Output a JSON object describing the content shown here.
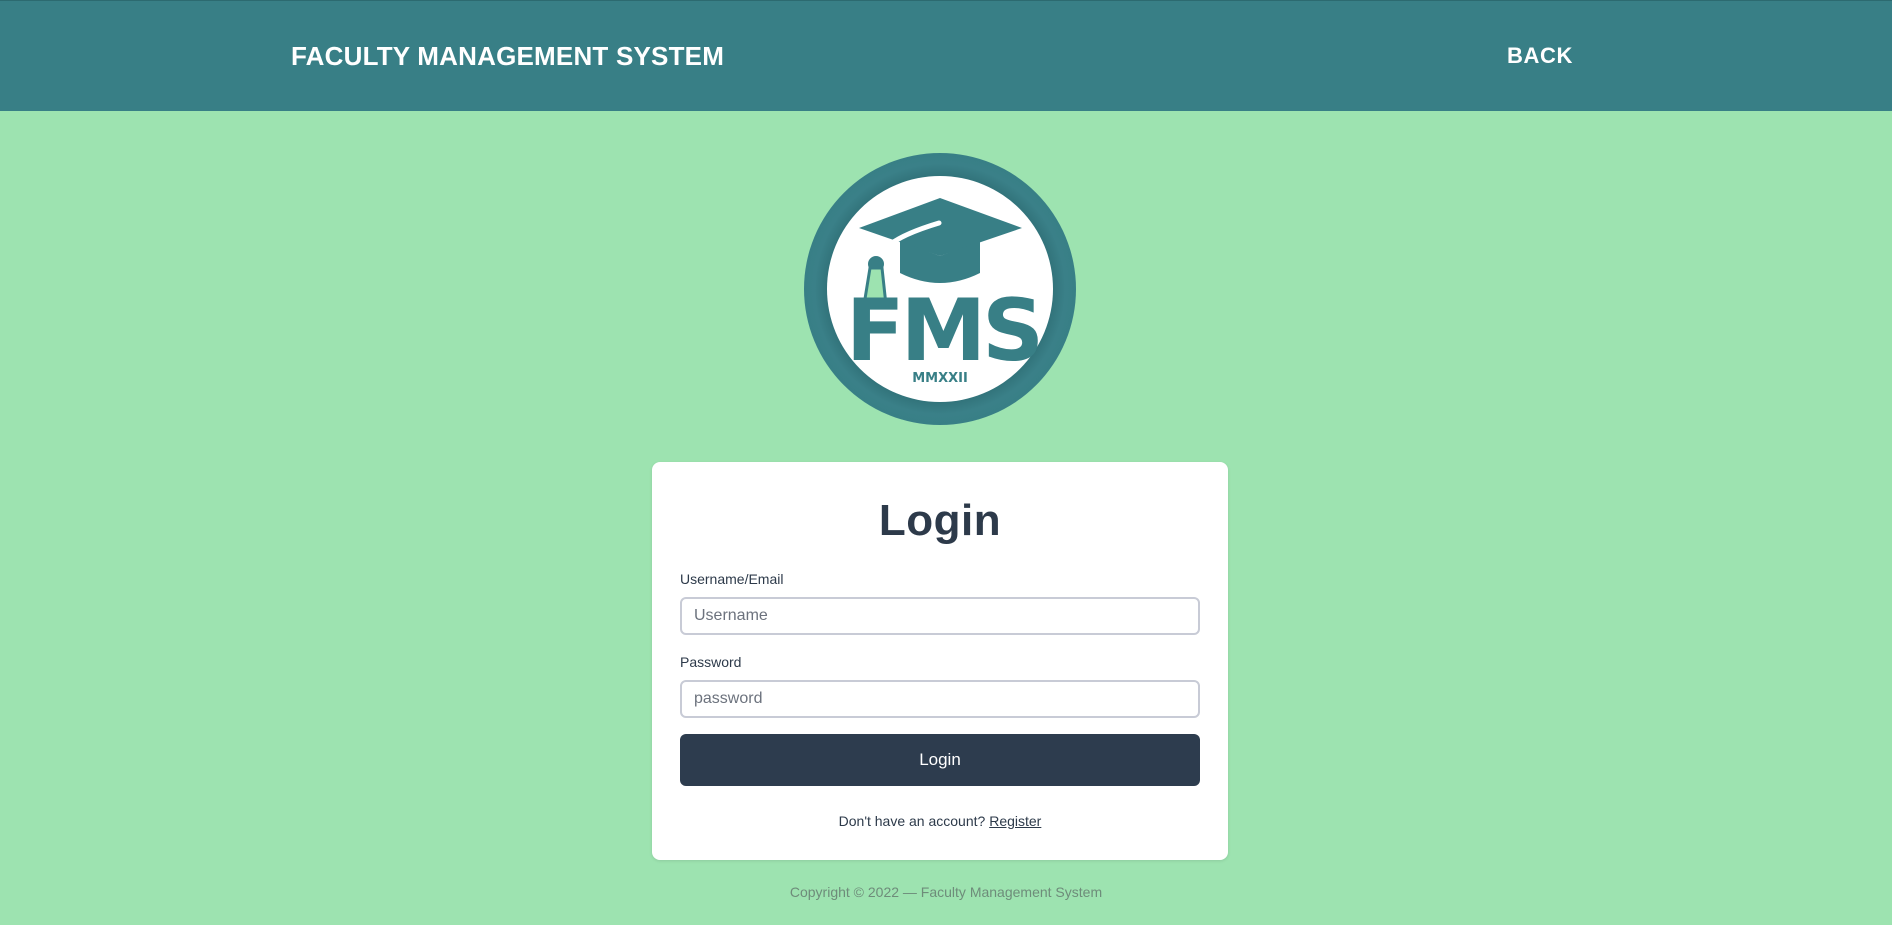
{
  "navbar": {
    "brand": "FACULTY MANAGEMENT SYSTEM",
    "back_label": "BACK"
  },
  "logo": {
    "text": "FMS",
    "year": "MMXXII",
    "colors": {
      "ring": "#387f86",
      "inner": "#ffffff",
      "accent": "#9de3b0"
    }
  },
  "login": {
    "title": "Login",
    "username_label": "Username/Email",
    "username_placeholder": "Username",
    "password_label": "Password",
    "password_placeholder": "password",
    "button_label": "Login",
    "register_prompt": "Don't have an account?",
    "register_link": "Register"
  },
  "footer": {
    "copyright": "Copyright © 2022 — Faculty Management System"
  },
  "colors": {
    "background": "#9de3b0",
    "navbar": "#387f86",
    "button": "#2d3c4e",
    "text_dark": "#2d3a4a"
  }
}
